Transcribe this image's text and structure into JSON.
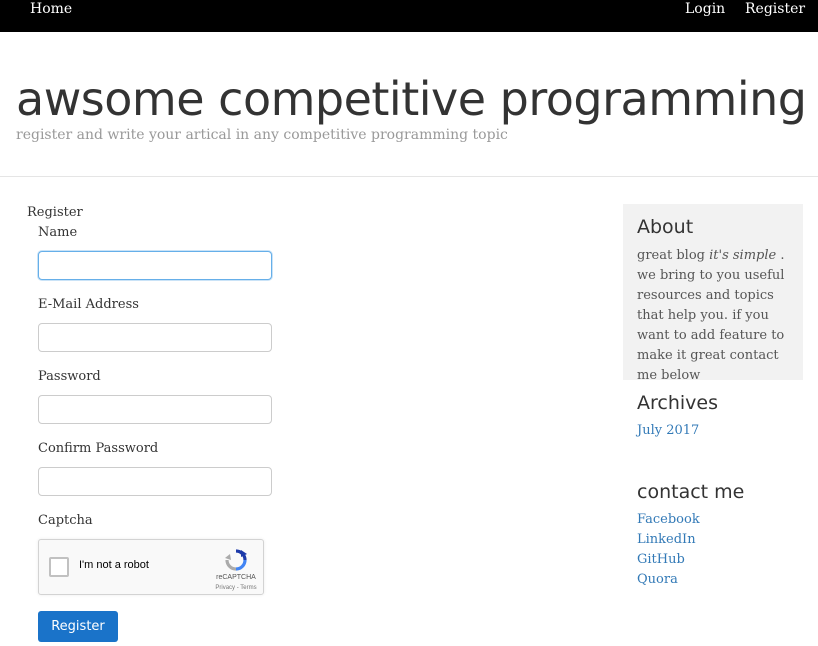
{
  "nav": {
    "home": "Home",
    "login": "Login",
    "register": "Register"
  },
  "header": {
    "title": "awsome competitive programming",
    "tagline": "register and write your artical in any competitive programming topic"
  },
  "form": {
    "title": "Register",
    "name_label": "Name",
    "email_label": "E-Mail Address",
    "password_label": "Password",
    "confirm_label": "Confirm Password",
    "captcha_label": "Captcha",
    "captcha": {
      "text": "I'm not a robot",
      "brand": "reCAPTCHA",
      "links": "Privacy - Terms"
    },
    "submit": "Register"
  },
  "sidebar": {
    "about_heading": "About",
    "about_prefix": "great blog ",
    "about_emphasis": "it's simple",
    "about_suffix": " . we bring to you useful resources and topics that help you. if you want to add feature to make it great contact me below",
    "archives_heading": "Archives",
    "archives": [
      "July 2017"
    ],
    "contact_heading": "contact me",
    "contacts": [
      "Facebook",
      "LinkedIn",
      "GitHub",
      "Quora"
    ]
  },
  "colors": {
    "nav_bg": "#000000",
    "primary_button": "#1a73c9",
    "link": "#337ab7",
    "panel_bg": "#f2f2f2"
  }
}
